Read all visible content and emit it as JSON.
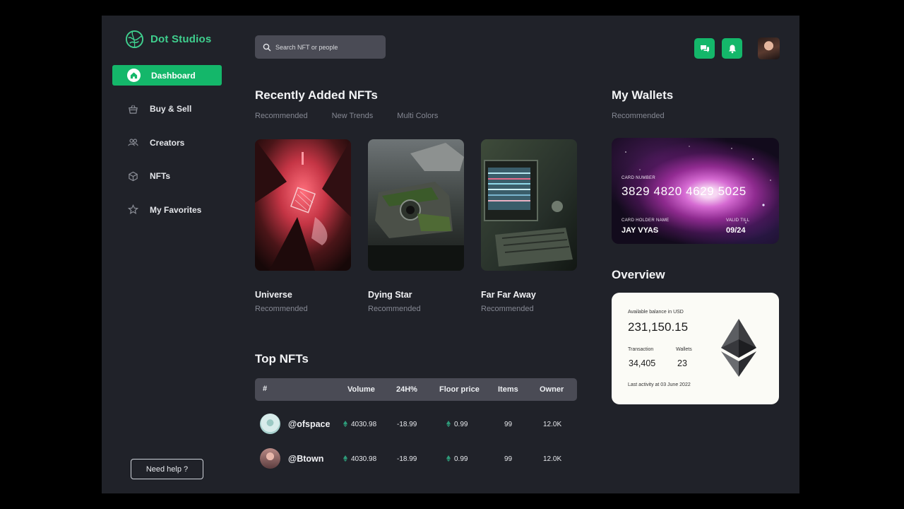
{
  "app": {
    "name": "Dot Studios"
  },
  "sidebar": {
    "items": [
      {
        "label": "Dashboard",
        "icon": "home-icon",
        "active": true
      },
      {
        "label": "Buy & Sell",
        "icon": "basket-icon"
      },
      {
        "label": "Creators",
        "icon": "users-icon"
      },
      {
        "label": "NFTs",
        "icon": "cube-icon"
      },
      {
        "label": "My Favorites",
        "icon": "star-icon"
      }
    ],
    "help_label": "Need help ?"
  },
  "header": {
    "search_placeholder": "Search NFT or people",
    "icons": [
      "chat-icon",
      "bell-icon"
    ]
  },
  "recent": {
    "title": "Recently Added NFTs",
    "tabs": [
      "Recommended",
      "New Trends",
      "Multi Colors"
    ],
    "cards": [
      {
        "name": "Universe",
        "subtitle": "Recommended"
      },
      {
        "name": "Dying Star",
        "subtitle": "Recommended"
      },
      {
        "name": "Far Far Away",
        "subtitle": "Recommended"
      }
    ]
  },
  "top_nfts": {
    "title": "Top NFTs",
    "columns": [
      "#",
      "Volume",
      "24H%",
      "Floor price",
      "Items",
      "Owner"
    ],
    "rows": [
      {
        "handle": "@ofspace",
        "volume": "4030.98",
        "change": "-18.99",
        "floor": "0.99",
        "items": "99",
        "owner": "12.0K"
      },
      {
        "handle": "@Btown",
        "volume": "4030.98",
        "change": "-18.99",
        "floor": "0.99",
        "items": "99",
        "owner": "12.0K"
      }
    ]
  },
  "wallets": {
    "title": "My Wallets",
    "subtitle": "Recommended",
    "card": {
      "number_label": "Card Number",
      "number": "3829 4820 4629 5025",
      "holder_label": "Card Holder Name",
      "holder": "JAY VYAS",
      "valid_label": "Valid Till",
      "valid": "09/24"
    }
  },
  "overview": {
    "title": "Overview",
    "balance_label": "Available balance in USD",
    "balance": "231,150.15",
    "transaction_label": "Transaction",
    "transaction": "34,405",
    "wallets_label": "Wallets",
    "wallets": "23",
    "last_activity": "Last activity at 03 June 2022"
  },
  "colors": {
    "accent": "#14b76a",
    "background": "#202229",
    "panel": "#4a4b55",
    "muted_text": "#858893",
    "logo_text": "#3fcf8e"
  }
}
